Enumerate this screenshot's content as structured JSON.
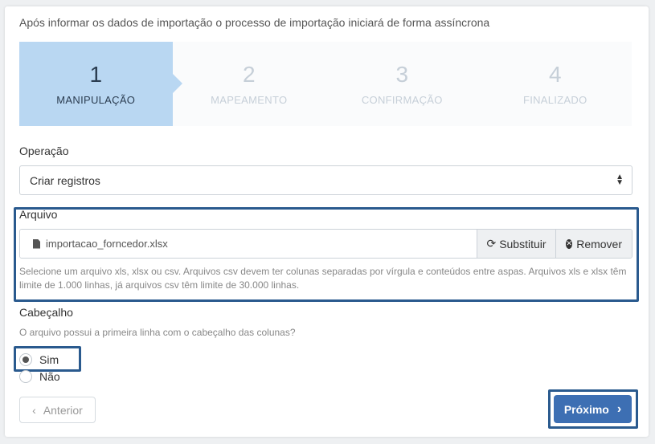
{
  "intro": "Após informar os dados de importação o processo de importação iniciará de forma assíncrona",
  "steps": [
    {
      "num": "1",
      "label": "MANIPULAÇÃO"
    },
    {
      "num": "2",
      "label": "MAPEAMENTO"
    },
    {
      "num": "3",
      "label": "CONFIRMAÇÃO"
    },
    {
      "num": "4",
      "label": "FINALIZADO"
    }
  ],
  "operation": {
    "label": "Operação",
    "value": "Criar registros"
  },
  "file": {
    "label": "Arquivo",
    "name": "importacao_forncedor.xlsx",
    "replace_label": "Substituir",
    "remove_label": "Remover",
    "help": "Selecione um arquivo xls, xlsx ou csv. Arquivos csv devem ter colunas separadas por vírgula e conteúdos entre aspas. Arquivos xls e xlsx têm limite de 1.000 linhas, já arquivos csv têm limite de 30.000 linhas."
  },
  "header": {
    "label": "Cabeçalho",
    "question": "O arquivo possui a primeira linha com o cabeçalho das colunas?",
    "options": [
      "Sim",
      "Não"
    ],
    "selected": "Sim"
  },
  "nav": {
    "prev_label": "Anterior",
    "next_label": "Próximo"
  },
  "colors": {
    "active_step": "#b9d7f2",
    "highlight": "#2a5a8e",
    "primary": "#3d6fb3"
  }
}
